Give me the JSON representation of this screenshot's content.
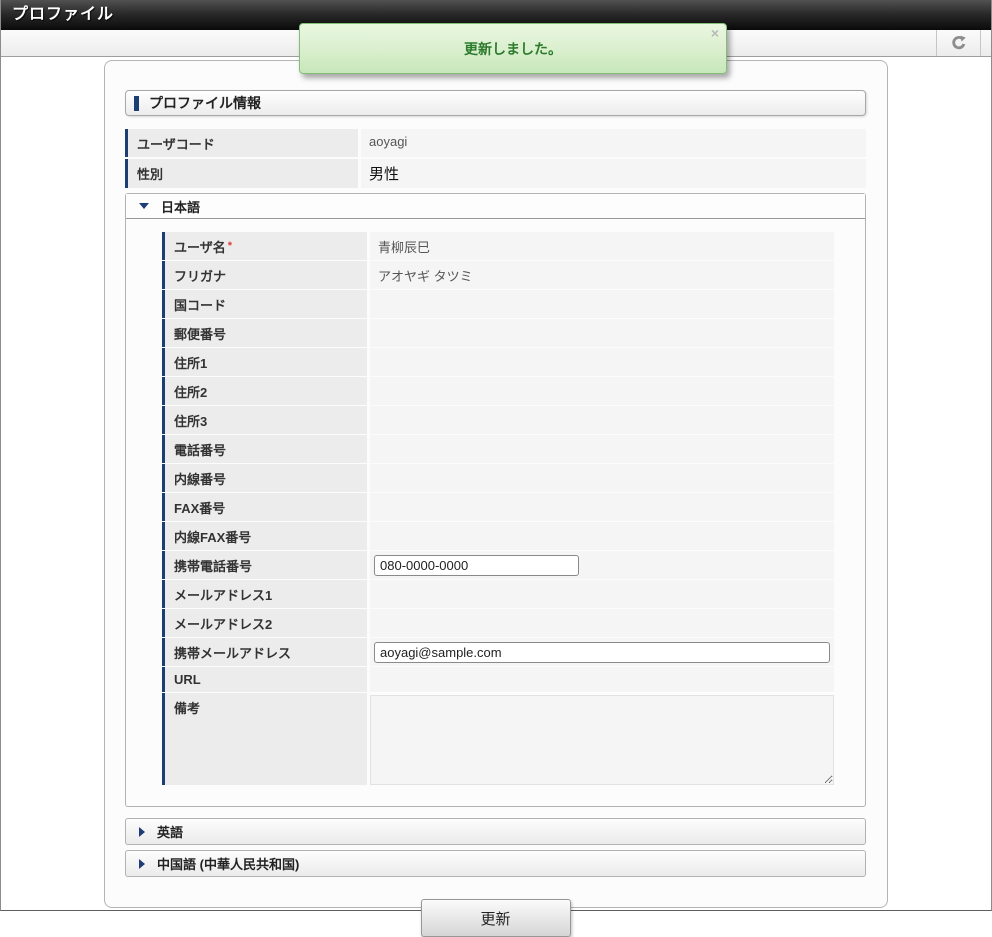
{
  "window": {
    "title": "プロファイル"
  },
  "toolbar": {
    "refresh_icon": "refresh-circular-arrow"
  },
  "toast": {
    "message": "更新しました。",
    "close": "×"
  },
  "profile": {
    "box_title": "プロファイル情報",
    "top_rows": [
      {
        "name": "user-code",
        "label": "ユーザコード",
        "value": "aoyagi",
        "emphasis": false
      },
      {
        "name": "gender",
        "label": "性別",
        "value": "男性",
        "emphasis": true
      }
    ]
  },
  "sections": {
    "japanese": {
      "label": "日本語",
      "expanded": true,
      "collapse_icon": "triangle-down",
      "rows": [
        {
          "name": "user-name",
          "label": "ユーザ名",
          "required": "*",
          "type": "static",
          "value": "青柳辰巳"
        },
        {
          "name": "furigana",
          "label": "フリガナ",
          "type": "static",
          "value": "アオヤギ タツミ"
        },
        {
          "name": "country-code",
          "label": "国コード",
          "type": "static",
          "value": ""
        },
        {
          "name": "postal-code",
          "label": "郵便番号",
          "type": "static",
          "value": ""
        },
        {
          "name": "address-1",
          "label": "住所1",
          "type": "static",
          "value": ""
        },
        {
          "name": "address-2",
          "label": "住所2",
          "type": "static",
          "value": ""
        },
        {
          "name": "address-3",
          "label": "住所3",
          "type": "static",
          "value": ""
        },
        {
          "name": "phone-number",
          "label": "電話番号",
          "type": "static",
          "value": ""
        },
        {
          "name": "extension-number",
          "label": "内線番号",
          "type": "static",
          "value": ""
        },
        {
          "name": "fax-number",
          "label": "FAX番号",
          "type": "static",
          "value": ""
        },
        {
          "name": "extension-fax-number",
          "label": "内線FAX番号",
          "type": "static",
          "value": ""
        },
        {
          "name": "mobile-phone-number",
          "label": "携帯電話番号",
          "type": "input",
          "input_size": "small",
          "value": "080-0000-0000"
        },
        {
          "name": "email-address-1",
          "label": "メールアドレス1",
          "type": "static",
          "value": ""
        },
        {
          "name": "email-address-2",
          "label": "メールアドレス2",
          "type": "static",
          "value": ""
        },
        {
          "name": "mobile-email-address",
          "label": "携帯メールアドレス",
          "type": "input",
          "input_size": "large",
          "value": "aoyagi@sample.com"
        },
        {
          "name": "url",
          "label": "URL",
          "type": "static",
          "value": ""
        },
        {
          "name": "remarks",
          "label": "備考",
          "type": "textarea",
          "value": ""
        }
      ]
    },
    "english": {
      "label": "英語",
      "expanded": false,
      "collapse_icon": "triangle-right"
    },
    "chinese": {
      "label": "中国語 (中華人民共和国)",
      "expanded": false,
      "collapse_icon": "triangle-right"
    }
  },
  "actions": {
    "update_label": "更新"
  },
  "colors": {
    "accent_navy": "#1d3e74",
    "titlebar_bg": "#1a1a1a",
    "toast_border": "#84bd78",
    "toast_bg_top": "#eaf7e1",
    "toast_bg_bottom": "#c7e7ba",
    "toast_text": "#2c7a2c",
    "required_mark": "#e03a3a",
    "label_cell_bg": "#ececec",
    "value_cell_bg": "#f5f5f5"
  }
}
